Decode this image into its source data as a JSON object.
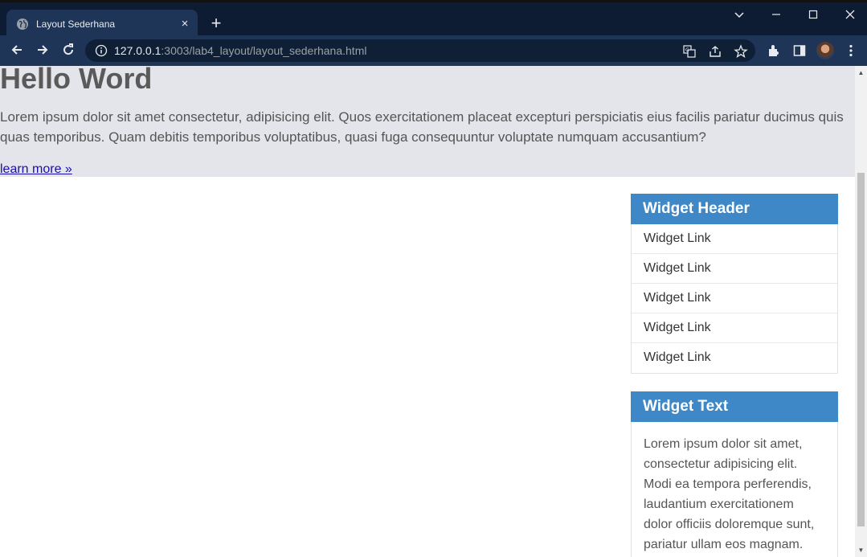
{
  "browser": {
    "tab_title": "Layout Sederhana",
    "tab_close": "×",
    "new_tab": "+",
    "url_host": "127.0.0.1",
    "url_path": ":3003/lab4_layout/layout_sederhana.html",
    "window_controls": {
      "minimize": "—",
      "maximize": "☐",
      "close": "✕",
      "tab_search": "⌄"
    },
    "nav": {
      "back": "←",
      "forward": "→",
      "reload": "↻",
      "menu": "⋮"
    }
  },
  "page": {
    "heading": "Hello Word",
    "lead": "Lorem ipsum dolor sit amet consectetur, adipisicing elit. Quos exercitationem placeat excepturi perspiciatis eius facilis pariatur ducimus quis quas temporibus. Quam debitis temporibus voluptatibus, quasi fuga consequuntur voluptate numquam accusantium?",
    "learn_more": "learn more »"
  },
  "sidebar": {
    "widget1": {
      "header": "Widget Header",
      "links": [
        "Widget Link",
        "Widget Link",
        "Widget Link",
        "Widget Link",
        "Widget Link"
      ]
    },
    "widget2": {
      "header": "Widget Text",
      "text": "Lorem ipsum dolor sit amet, consectetur adipisicing elit. Modi ea tempora perferendis, laudantium exercitationem dolor officiis doloremque sunt, pariatur ullam eos magnam."
    }
  },
  "colors": {
    "chrome_dark": "#0d1b33",
    "chrome_toolbar": "#1e3558",
    "jumbotron_bg": "#e4e5eb",
    "widget_header": "#3f88c8",
    "link": "#1a0dab"
  }
}
